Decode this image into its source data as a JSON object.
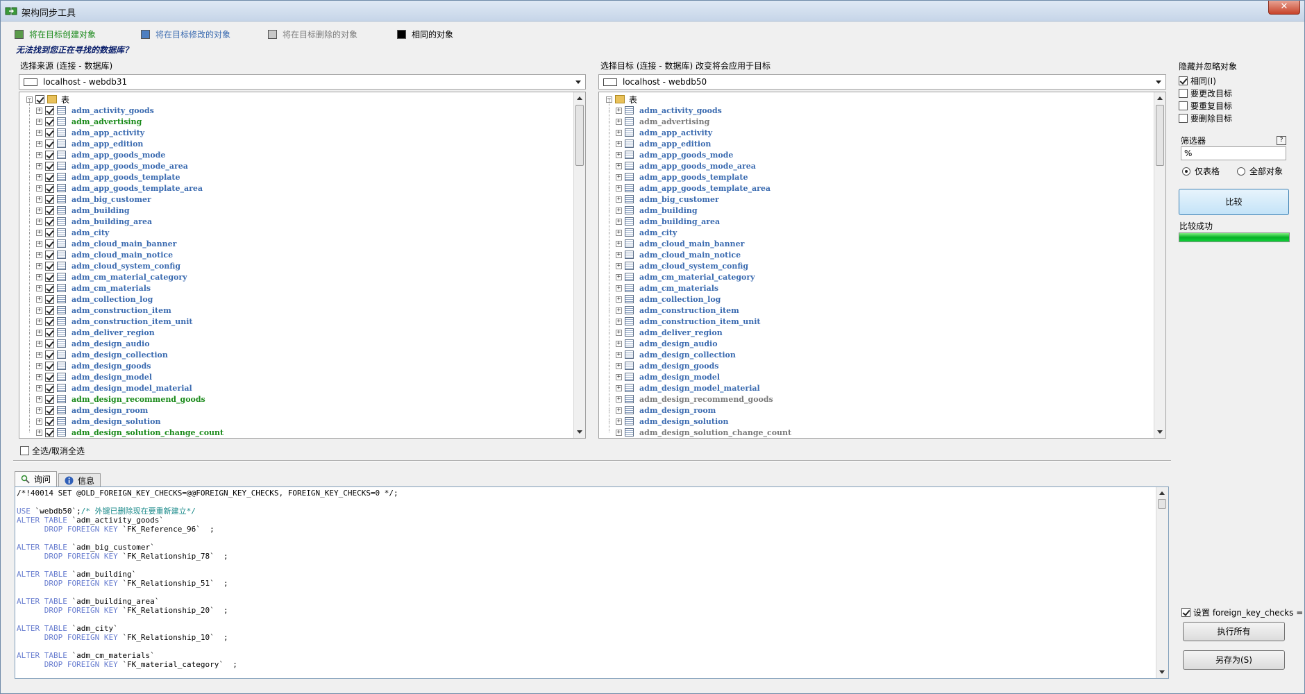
{
  "window": {
    "title": "架构同步工具",
    "close_label": "✕"
  },
  "legend": [
    {
      "label": "将在目标创建对象",
      "color": "#5a9a4a",
      "text_color": "#1a8a1a"
    },
    {
      "label": "将在目标修改的对象",
      "color": "#4f7fc0",
      "text_color": "#3b6bb0"
    },
    {
      "label": "将在目标删除的对象",
      "color": "#c8c8c8",
      "text_color": "#7a7a7a"
    },
    {
      "label": "相同的对象",
      "color": "#000000",
      "text_color": "#000000"
    }
  ],
  "hint": "无法找到您正在寻找的数据库？",
  "source": {
    "label": "选择来源 (连接 - 数据库)",
    "connection": "localhost - webdb31",
    "root": "表",
    "items": [
      {
        "name": "adm_activity_goods",
        "state": "modify"
      },
      {
        "name": "adm_advertising",
        "state": "create"
      },
      {
        "name": "adm_app_activity",
        "state": "modify"
      },
      {
        "name": "adm_app_edition",
        "state": "modify"
      },
      {
        "name": "adm_app_goods_mode",
        "state": "modify"
      },
      {
        "name": "adm_app_goods_mode_area",
        "state": "modify"
      },
      {
        "name": "adm_app_goods_template",
        "state": "modify"
      },
      {
        "name": "adm_app_goods_template_area",
        "state": "modify"
      },
      {
        "name": "adm_big_customer",
        "state": "modify"
      },
      {
        "name": "adm_building",
        "state": "modify"
      },
      {
        "name": "adm_building_area",
        "state": "modify"
      },
      {
        "name": "adm_city",
        "state": "modify"
      },
      {
        "name": "adm_cloud_main_banner",
        "state": "modify"
      },
      {
        "name": "adm_cloud_main_notice",
        "state": "modify"
      },
      {
        "name": "adm_cloud_system_config",
        "state": "modify"
      },
      {
        "name": "adm_cm_material_category",
        "state": "modify"
      },
      {
        "name": "adm_cm_materials",
        "state": "modify"
      },
      {
        "name": "adm_collection_log",
        "state": "modify"
      },
      {
        "name": "adm_construction_item",
        "state": "modify"
      },
      {
        "name": "adm_construction_item_unit",
        "state": "modify"
      },
      {
        "name": "adm_deliver_region",
        "state": "modify"
      },
      {
        "name": "adm_design_audio",
        "state": "modify"
      },
      {
        "name": "adm_design_collection",
        "state": "modify"
      },
      {
        "name": "adm_design_goods",
        "state": "modify"
      },
      {
        "name": "adm_design_model",
        "state": "modify"
      },
      {
        "name": "adm_design_model_material",
        "state": "modify"
      },
      {
        "name": "adm_design_recommend_goods",
        "state": "create"
      },
      {
        "name": "adm_design_room",
        "state": "modify"
      },
      {
        "name": "adm_design_solution",
        "state": "modify"
      },
      {
        "name": "adm_design_solution_change_count",
        "state": "create"
      }
    ]
  },
  "target": {
    "label": "选择目标 (连接 - 数据库) 改变将会应用于目标",
    "connection": "localhost - webdb50",
    "root": "表",
    "items": [
      {
        "name": "adm_activity_goods",
        "state": "modify"
      },
      {
        "name": "adm_advertising",
        "state": "none"
      },
      {
        "name": "adm_app_activity",
        "state": "modify"
      },
      {
        "name": "adm_app_edition",
        "state": "modify"
      },
      {
        "name": "adm_app_goods_mode",
        "state": "modify"
      },
      {
        "name": "adm_app_goods_mode_area",
        "state": "modify"
      },
      {
        "name": "adm_app_goods_template",
        "state": "modify"
      },
      {
        "name": "adm_app_goods_template_area",
        "state": "modify"
      },
      {
        "name": "adm_big_customer",
        "state": "modify"
      },
      {
        "name": "adm_building",
        "state": "modify"
      },
      {
        "name": "adm_building_area",
        "state": "modify"
      },
      {
        "name": "adm_city",
        "state": "modify"
      },
      {
        "name": "adm_cloud_main_banner",
        "state": "modify"
      },
      {
        "name": "adm_cloud_main_notice",
        "state": "modify"
      },
      {
        "name": "adm_cloud_system_config",
        "state": "modify"
      },
      {
        "name": "adm_cm_material_category",
        "state": "modify"
      },
      {
        "name": "adm_cm_materials",
        "state": "modify"
      },
      {
        "name": "adm_collection_log",
        "state": "modify"
      },
      {
        "name": "adm_construction_item",
        "state": "modify"
      },
      {
        "name": "adm_construction_item_unit",
        "state": "modify"
      },
      {
        "name": "adm_deliver_region",
        "state": "modify"
      },
      {
        "name": "adm_design_audio",
        "state": "modify"
      },
      {
        "name": "adm_design_collection",
        "state": "modify"
      },
      {
        "name": "adm_design_goods",
        "state": "modify"
      },
      {
        "name": "adm_design_model",
        "state": "modify"
      },
      {
        "name": "adm_design_model_material",
        "state": "modify"
      },
      {
        "name": "adm_design_recommend_goods",
        "state": "none"
      },
      {
        "name": "adm_design_room",
        "state": "modify"
      },
      {
        "name": "adm_design_solution",
        "state": "modify"
      },
      {
        "name": "adm_design_solution_change_count",
        "state": "none"
      }
    ]
  },
  "select_all_label": "全选/取消全选",
  "hide_group": {
    "title": "隐藏并忽略对象",
    "options": [
      {
        "label": "相同(I)",
        "checked": true
      },
      {
        "label": "要更改目标",
        "checked": false
      },
      {
        "label": "要重复目标",
        "checked": false
      },
      {
        "label": "要删除目标",
        "checked": false
      }
    ]
  },
  "filter": {
    "title": "筛选器",
    "help": "?",
    "value": "%",
    "radio_tables": "仅表格",
    "radio_all": "全部对象",
    "selected": "tables"
  },
  "compare_button": "比较",
  "compare_status": "比较成功",
  "progress_value": 1.0,
  "tabs": [
    {
      "label": "询问",
      "active": true
    },
    {
      "label": "信息",
      "active": false
    }
  ],
  "sql": [
    [
      {
        "t": "/*!40014 SET @OLD_FOREIGN_KEY_CHECKS=@@FOREIGN_KEY_CHECKS, FOREIGN_KEY_CHECKS=0 */;",
        "c": ""
      }
    ],
    [
      {
        "t": "",
        "c": ""
      }
    ],
    [
      {
        "t": "USE",
        "c": "kw"
      },
      {
        "t": " `webdb50`;",
        "c": ""
      },
      {
        "t": "/* 外键已删除现在要重新建立*/",
        "c": "cm"
      }
    ],
    [
      {
        "t": "ALTER TABLE",
        "c": "kw"
      },
      {
        "t": " `adm_activity_goods`",
        "c": ""
      }
    ],
    [
      {
        "t": "      DROP FOREIGN KEY",
        "c": "kw"
      },
      {
        "t": " `FK_Reference_96`  ;",
        "c": ""
      }
    ],
    [
      {
        "t": "",
        "c": ""
      }
    ],
    [
      {
        "t": "ALTER TABLE",
        "c": "kw"
      },
      {
        "t": " `adm_big_customer`",
        "c": ""
      }
    ],
    [
      {
        "t": "      DROP FOREIGN KEY",
        "c": "kw"
      },
      {
        "t": " `FK_Relationship_78`  ;",
        "c": ""
      }
    ],
    [
      {
        "t": "",
        "c": ""
      }
    ],
    [
      {
        "t": "ALTER TABLE",
        "c": "kw"
      },
      {
        "t": " `adm_building`",
        "c": ""
      }
    ],
    [
      {
        "t": "      DROP FOREIGN KEY",
        "c": "kw"
      },
      {
        "t": " `FK_Relationship_51`  ;",
        "c": ""
      }
    ],
    [
      {
        "t": "",
        "c": ""
      }
    ],
    [
      {
        "t": "ALTER TABLE",
        "c": "kw"
      },
      {
        "t": " `adm_building_area`",
        "c": ""
      }
    ],
    [
      {
        "t": "      DROP FOREIGN KEY",
        "c": "kw"
      },
      {
        "t": " `FK_Relationship_20`  ;",
        "c": ""
      }
    ],
    [
      {
        "t": "",
        "c": ""
      }
    ],
    [
      {
        "t": "ALTER TABLE",
        "c": "kw"
      },
      {
        "t": " `adm_city`",
        "c": ""
      }
    ],
    [
      {
        "t": "      DROP FOREIGN KEY",
        "c": "kw"
      },
      {
        "t": " `FK_Relationship_10`  ;",
        "c": ""
      }
    ],
    [
      {
        "t": "",
        "c": ""
      }
    ],
    [
      {
        "t": "ALTER TABLE",
        "c": "kw"
      },
      {
        "t": " `adm_cm_materials`",
        "c": ""
      }
    ],
    [
      {
        "t": "      DROP FOREIGN KEY",
        "c": "kw"
      },
      {
        "t": " `FK_material_category`  ;",
        "c": ""
      }
    ]
  ],
  "fk_check_label": "设置 foreign_key_checks =",
  "fk_check_checked": true,
  "exec_button": "执行所有",
  "saveas_button": "另存为(S)"
}
